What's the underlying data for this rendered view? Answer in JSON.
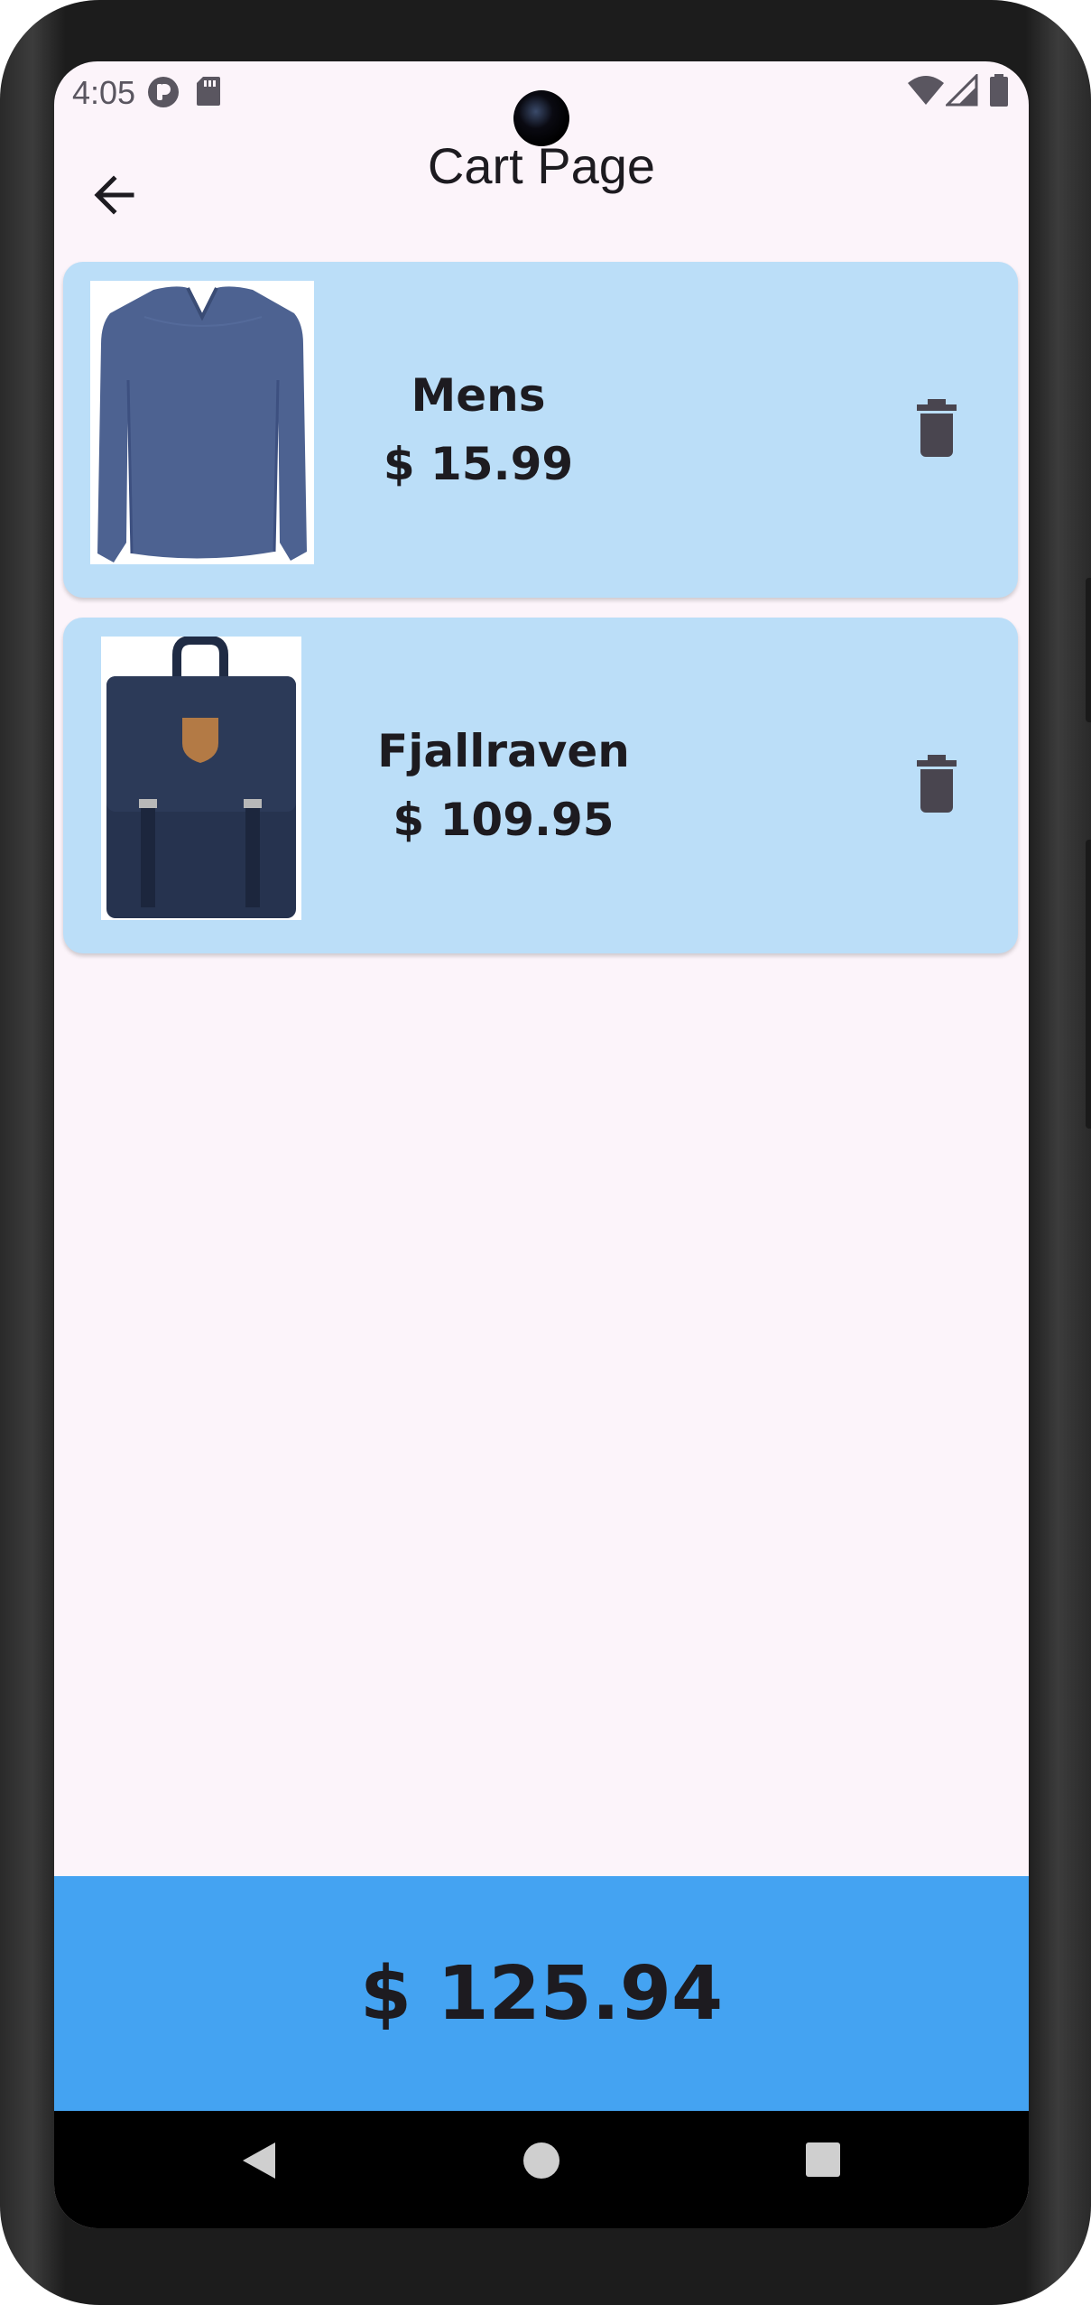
{
  "status_bar": {
    "time": "4:05",
    "left_icons": [
      "pocket-icon",
      "sd-card-icon"
    ],
    "right_icons": [
      "wifi-icon",
      "signal-icon",
      "battery-icon"
    ]
  },
  "app_bar": {
    "title": "Cart Page",
    "back_icon": "arrow-back-icon"
  },
  "cart": {
    "items": [
      {
        "name": "Mens",
        "price": "$ 15.99",
        "image": "long-sleeve-shirt",
        "delete_icon": "trash-icon"
      },
      {
        "name": "Fjallraven",
        "price": "$ 109.95",
        "image": "backpack",
        "delete_icon": "trash-icon"
      }
    ]
  },
  "total": {
    "amount": "$ 125.94"
  },
  "nav_bar": {
    "buttons": [
      "back-triangle-icon",
      "home-circle-icon",
      "recents-square-icon"
    ]
  },
  "colors": {
    "background": "#fcf4fa",
    "card": "#bbdef8",
    "total_bar": "#44a3f2",
    "text": "#1d1b20"
  }
}
